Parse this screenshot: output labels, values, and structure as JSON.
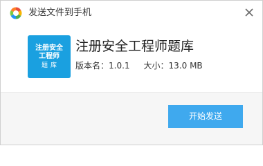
{
  "window": {
    "title": "发送文件到手机",
    "logo_icon": "360-logo-icon",
    "close_icon": "close-icon"
  },
  "app": {
    "name": "注册安全工程师题库",
    "icon_text_line1": "注册安全",
    "icon_text_line2": "工程师",
    "icon_text_line3": "题库",
    "version_label": "版本名：1.0.1",
    "size_label": "大小：13.0 MB"
  },
  "actions": {
    "start_send_label": "开始发送"
  },
  "colors": {
    "accent": "#3fa9ee",
    "icon_bg": "#1aa0e0",
    "footer_bg": "#f6f6f6"
  }
}
